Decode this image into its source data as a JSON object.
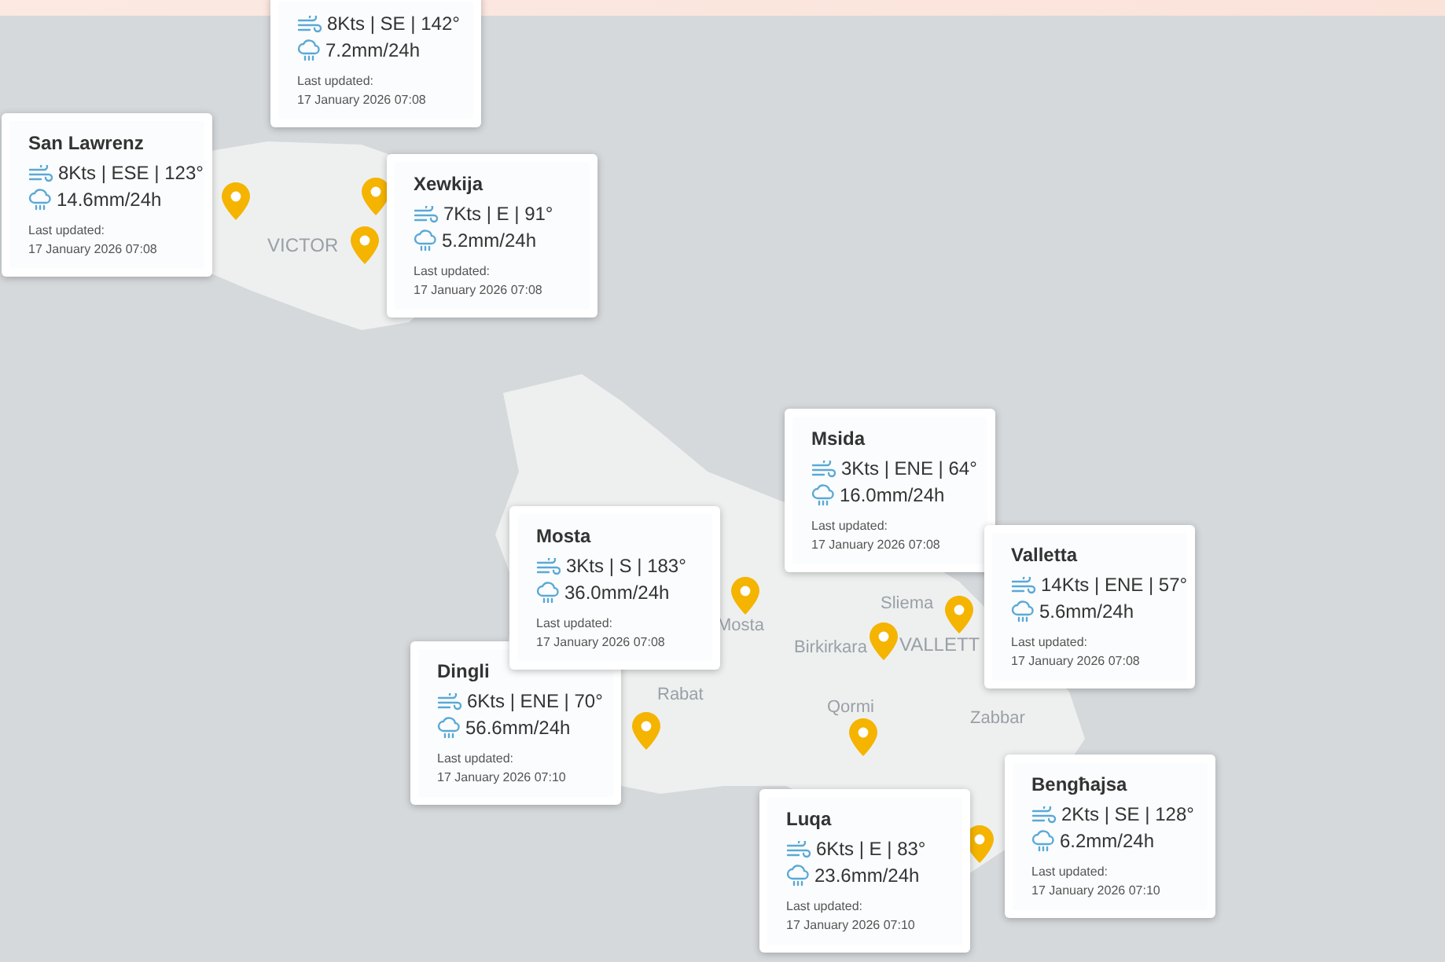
{
  "map_labels": [
    {
      "text": "VICTOR",
      "kind": "town"
    },
    {
      "text": "Mosta",
      "kind": "place"
    },
    {
      "text": "Rabat",
      "kind": "place"
    },
    {
      "text": "Birkirkara",
      "kind": "place"
    },
    {
      "text": "Sliema",
      "kind": "place"
    },
    {
      "text": "VALLETT",
      "kind": "town"
    },
    {
      "text": "Qormi",
      "kind": "place"
    },
    {
      "text": "Zabbar",
      "kind": "place"
    }
  ],
  "stations": [
    {
      "wind": "8Kts | SE | 142°",
      "rain": "7.2mm/24h",
      "updated_label": "Last updated:",
      "updated": "17 January 2026 07:08"
    },
    {
      "name": "San Lawrenz",
      "wind": "8Kts | ESE | 123°",
      "rain": "14.6mm/24h",
      "updated_label": "Last updated:",
      "updated": "17 January 2026 07:08"
    },
    {
      "name": "Xewkija",
      "wind": "7Kts | E | 91°",
      "rain": "5.2mm/24h",
      "updated_label": "Last updated:",
      "updated": "17 January 2026 07:08"
    },
    {
      "name": "Msida",
      "wind": "3Kts | ENE | 64°",
      "rain": "16.0mm/24h",
      "updated_label": "Last updated:",
      "updated": "17 January 2026 07:08"
    },
    {
      "name": "Mosta",
      "wind": "3Kts | S | 183°",
      "rain": "36.0mm/24h",
      "updated_label": "Last updated:",
      "updated": "17 January 2026 07:08"
    },
    {
      "name": "Valletta",
      "wind": "14Kts | ENE | 57°",
      "rain": "5.6mm/24h",
      "updated_label": "Last updated:",
      "updated": "17 January 2026 07:08"
    },
    {
      "name": "Dingli",
      "wind": "6Kts | ENE | 70°",
      "rain": "56.6mm/24h",
      "updated_label": "Last updated:",
      "updated": "17 January 2026 07:10"
    },
    {
      "name": "Bengħajsa",
      "wind": "2Kts | SE | 128°",
      "rain": "6.2mm/24h",
      "updated_label": "Last updated:",
      "updated": "17 January 2026 07:10"
    },
    {
      "name": "Luqa",
      "wind": "6Kts | E | 83°",
      "rain": "23.6mm/24h",
      "updated_label": "Last updated:",
      "updated": "17 January 2026 07:10"
    }
  ]
}
